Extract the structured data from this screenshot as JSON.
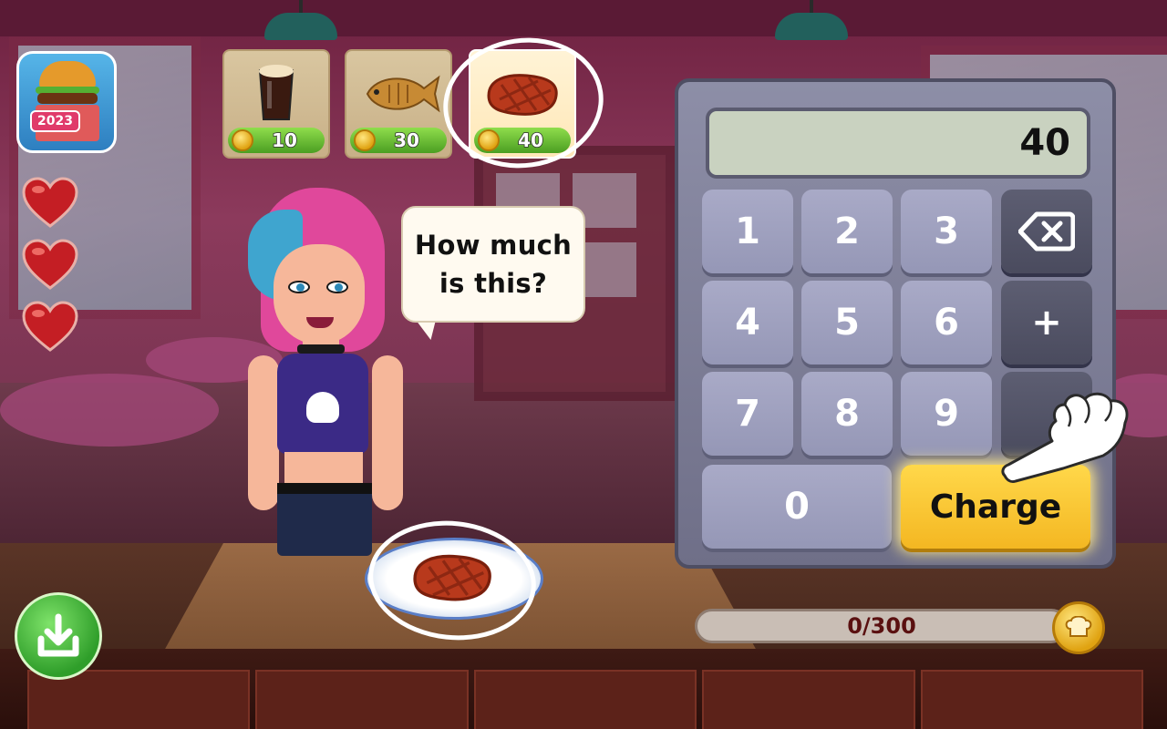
{
  "app_icon": {
    "badge": "2023"
  },
  "hearts": {
    "count": 3,
    "color": "#c41e24"
  },
  "orders": [
    {
      "item": "dark beer",
      "icon": "beer-icon",
      "price": "10",
      "selected": false
    },
    {
      "item": "roast fish",
      "icon": "fish-icon",
      "price": "30",
      "selected": false
    },
    {
      "item": "steak",
      "icon": "steak-icon",
      "price": "40",
      "selected": true
    }
  ],
  "speech": {
    "line1": "How much",
    "line2": "is this?"
  },
  "calculator": {
    "display_value": "40",
    "keys": {
      "k1": "1",
      "k2": "2",
      "k3": "3",
      "k4": "4",
      "k5": "5",
      "k6": "6",
      "k7": "7",
      "k8": "8",
      "k9": "9",
      "k0": "0",
      "plus": "+",
      "charge": "Charge"
    },
    "backspace_icon": "backspace-icon",
    "accent": "#f4b722"
  },
  "progress": {
    "text": "0/300",
    "fraction": 0
  },
  "plate": {
    "item": "steak"
  }
}
